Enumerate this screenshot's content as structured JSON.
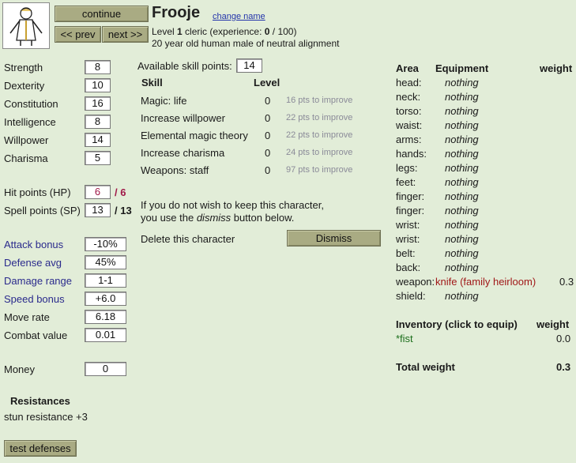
{
  "header": {
    "continue_label": "continue",
    "prev_label": "<< prev",
    "next_label": "next >>",
    "character_name": "Frooje",
    "change_name_label": "change name",
    "level_prefix": "Level ",
    "level_value": "1",
    "class_prefix": " cleric (experience: ",
    "exp_value": "0",
    "exp_suffix": " / 100)",
    "description": "20 year old human male of neutral alignment"
  },
  "attributes": [
    {
      "label": "Strength",
      "value": "8"
    },
    {
      "label": "Dexterity",
      "value": "10"
    },
    {
      "label": "Constitution",
      "value": "16"
    },
    {
      "label": "Intelligence",
      "value": "8"
    },
    {
      "label": "Willpower",
      "value": "14"
    },
    {
      "label": "Charisma",
      "value": "5"
    }
  ],
  "vitals": {
    "hp_label": "Hit points (HP)",
    "hp_value": "6",
    "hp_max": "/ 6",
    "sp_label": "Spell points (SP)",
    "sp_value": "13",
    "sp_max": "/ 13"
  },
  "combat": [
    {
      "label": "Attack bonus",
      "value": "-10%"
    },
    {
      "label": "Defense avg",
      "value": "45%"
    },
    {
      "label": "Damage range",
      "value": "1-1"
    },
    {
      "label": "Speed bonus",
      "value": "+6.0"
    },
    {
      "label": "Move rate",
      "value": "6.18"
    },
    {
      "label": "Combat value",
      "value": "0.01"
    }
  ],
  "money": {
    "label": "Money",
    "value": "0"
  },
  "resistances": {
    "title": "Resistances",
    "text": "stun resistance +3"
  },
  "test_defenses_label": "test defenses",
  "skills": {
    "available_label": "Available skill points:",
    "available_value": "14",
    "col_skill": "Skill",
    "col_level": "Level",
    "rows": [
      {
        "name": "Magic: life",
        "level": "0",
        "improve": "16 pts to improve"
      },
      {
        "name": "Increase willpower",
        "level": "0",
        "improve": "22 pts to improve"
      },
      {
        "name": "Elemental magic theory",
        "level": "0",
        "improve": "22 pts to improve"
      },
      {
        "name": "Increase charisma",
        "level": "0",
        "improve": "24 pts to improve"
      },
      {
        "name": "Weapons: staff",
        "level": "0",
        "improve": "97 pts to improve"
      }
    ]
  },
  "dismiss": {
    "line1": "If you do not wish to keep this character,",
    "line2_pre": "you use the ",
    "line2_em": "dismiss",
    "line2_post": " button below.",
    "delete_label": "Delete this character",
    "button_label": "Dismiss"
  },
  "equipment": {
    "col_area": "Area",
    "col_equipment": "Equipment",
    "col_weight": "weight",
    "rows": [
      {
        "area": "head:",
        "item": "nothing",
        "weight": ""
      },
      {
        "area": "neck:",
        "item": "nothing",
        "weight": ""
      },
      {
        "area": "torso:",
        "item": "nothing",
        "weight": ""
      },
      {
        "area": "waist:",
        "item": "nothing",
        "weight": ""
      },
      {
        "area": "arms:",
        "item": "nothing",
        "weight": ""
      },
      {
        "area": "hands:",
        "item": "nothing",
        "weight": ""
      },
      {
        "area": "legs:",
        "item": "nothing",
        "weight": ""
      },
      {
        "area": "feet:",
        "item": "nothing",
        "weight": ""
      },
      {
        "area": "finger:",
        "item": "nothing",
        "weight": ""
      },
      {
        "area": "finger:",
        "item": "nothing",
        "weight": ""
      },
      {
        "area": "wrist:",
        "item": "nothing",
        "weight": ""
      },
      {
        "area": "wrist:",
        "item": "nothing",
        "weight": ""
      },
      {
        "area": "belt:",
        "item": "nothing",
        "weight": ""
      },
      {
        "area": "back:",
        "item": "nothing",
        "weight": ""
      },
      {
        "area": "weapon:",
        "item": "knife (family heirloom)",
        "weight": "0.3"
      },
      {
        "area": "shield:",
        "item": "nothing",
        "weight": ""
      }
    ]
  },
  "inventory": {
    "title": "Inventory (click to equip)",
    "col_weight": "weight",
    "items": [
      {
        "name": "*fist",
        "weight": "0.0"
      }
    ]
  },
  "total": {
    "label": "Total weight",
    "value": "0.3"
  }
}
